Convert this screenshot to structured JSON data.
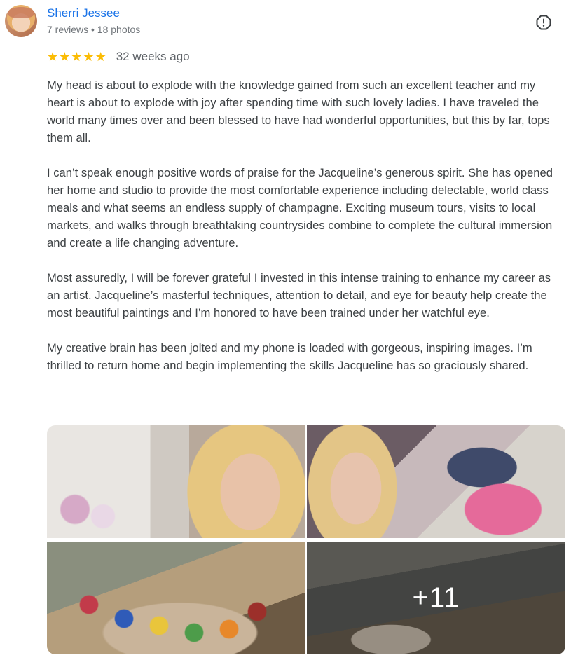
{
  "reviewer": {
    "name": "Sherri Jessee",
    "meta": "7 reviews • 18 photos"
  },
  "rating": {
    "stars": 5,
    "age": "32 weeks ago"
  },
  "review": {
    "paragraphs": [
      "My head is about to explode with the knowledge gained from such an excellent teacher and my heart is about to explode with joy after spending time with such lovely ladies. I have traveled the world many times over and been blessed to have had wonderful opportunities, but this by far, tops them all.",
      "I can’t speak enough positive words of praise for the Jacqueline’s generous spirit. She has opened her home and studio to provide the most comfortable experience including delectable, world class meals and what seems an endless supply of champagne. Exciting museum tours, visits to local markets, and walks through breathtaking countrysides combine to complete the cultural immersion and create a life changing adventure.",
      "Most assuredly, I will be forever grateful I invested in this intense training to enhance my career as an artist. Jacqueline’s masterful techniques, attention to detail, and eye for beauty help create the most beautiful paintings and I’m honored to have been trained under her watchful eye.",
      "My creative brain has been jolted and my phone is loaded with gorgeous, inspiring images. I’m thrilled to return home and begin implementing the skills Jacqueline has so graciously shared."
    ]
  },
  "photos": {
    "more_label": "+11"
  },
  "icons": {
    "report": "report-icon",
    "star": "star-icon"
  },
  "colors": {
    "name": "#1a73e8",
    "star": "#fbbc04"
  }
}
